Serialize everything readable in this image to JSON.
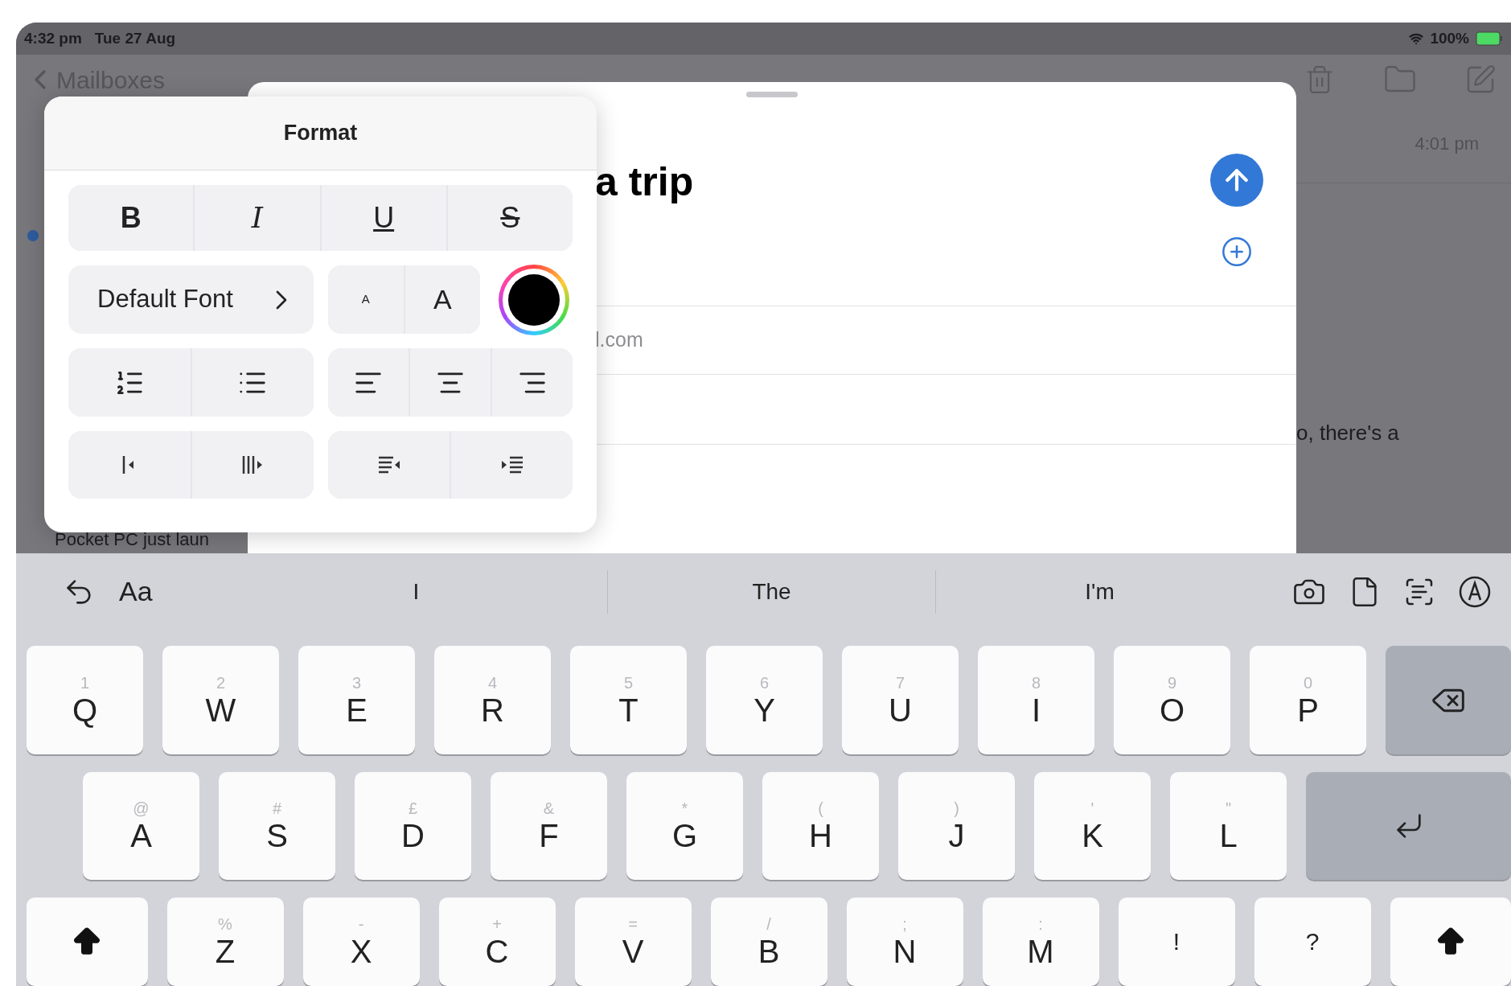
{
  "status_bar": {
    "time": "4:32 pm",
    "date": "Tue 27 Aug",
    "battery": "100%"
  },
  "background": {
    "back_label": "Mailboxes",
    "unread": true,
    "list_snippet": "Pocket PC just laun",
    "time": "4:01 pm",
    "preview": "o, there's a"
  },
  "compose": {
    "subject": "a trip",
    "recipient": "l.com"
  },
  "format_popover": {
    "title": "Format",
    "styles": [
      {
        "kind": "bold",
        "label": "B"
      },
      {
        "kind": "italic",
        "label": "I"
      },
      {
        "kind": "underline",
        "label": "U"
      },
      {
        "kind": "strikethrough",
        "label": "S"
      }
    ],
    "font": "Default Font",
    "sizes": [
      {
        "kind": "smaller",
        "label": "A"
      },
      {
        "kind": "larger",
        "label": "A"
      }
    ]
  },
  "keyboard": {
    "format_label": "Aa",
    "suggestions": [
      "I",
      "The",
      "I'm"
    ],
    "rows": [
      [
        {
          "kind": "char",
          "label": "Q",
          "alt": "1"
        },
        {
          "kind": "char",
          "label": "W",
          "alt": "2"
        },
        {
          "kind": "char",
          "label": "E",
          "alt": "3"
        },
        {
          "kind": "char",
          "label": "R",
          "alt": "4"
        },
        {
          "kind": "char",
          "label": "T",
          "alt": "5"
        },
        {
          "kind": "char",
          "label": "Y",
          "alt": "6"
        },
        {
          "kind": "char",
          "label": "U",
          "alt": "7"
        },
        {
          "kind": "char",
          "label": "I",
          "alt": "8"
        },
        {
          "kind": "char",
          "label": "O",
          "alt": "9"
        },
        {
          "kind": "char",
          "label": "P",
          "alt": "0"
        },
        {
          "kind": "delete"
        }
      ],
      [
        {
          "kind": "char",
          "label": "A",
          "alt": "@"
        },
        {
          "kind": "char",
          "label": "S",
          "alt": "#"
        },
        {
          "kind": "char",
          "label": "D",
          "alt": "£"
        },
        {
          "kind": "char",
          "label": "F",
          "alt": "&"
        },
        {
          "kind": "char",
          "label": "G",
          "alt": "*"
        },
        {
          "kind": "char",
          "label": "H",
          "alt": "("
        },
        {
          "kind": "char",
          "label": "J",
          "alt": ")"
        },
        {
          "kind": "char",
          "label": "K",
          "alt": "'"
        },
        {
          "kind": "char",
          "label": "L",
          "alt": "\""
        },
        {
          "kind": "return"
        }
      ],
      [
        {
          "kind": "shift"
        },
        {
          "kind": "char",
          "label": "Z",
          "alt": "%"
        },
        {
          "kind": "char",
          "label": "X",
          "alt": "-"
        },
        {
          "kind": "char",
          "label": "C",
          "alt": "+"
        },
        {
          "kind": "char",
          "label": "V",
          "alt": "="
        },
        {
          "kind": "char",
          "label": "B",
          "alt": "/"
        },
        {
          "kind": "char",
          "label": "N",
          "alt": ";"
        },
        {
          "kind": "char",
          "label": "M",
          "alt": ":"
        },
        {
          "kind": "punct",
          "label": "!"
        },
        {
          "kind": "punct",
          "label": "?"
        },
        {
          "kind": "shift"
        }
      ]
    ]
  }
}
